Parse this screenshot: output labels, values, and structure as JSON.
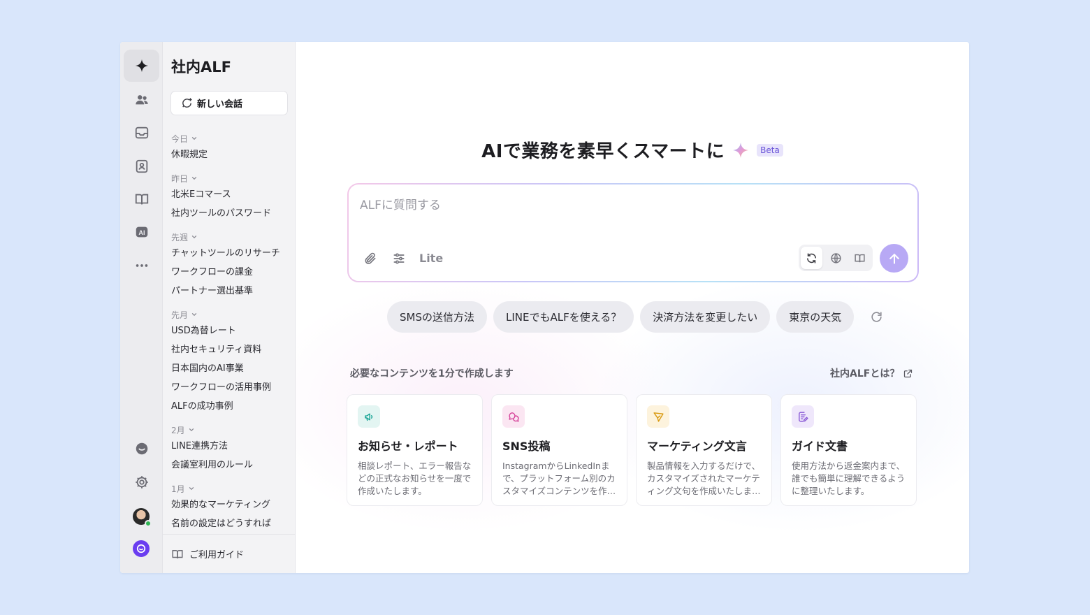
{
  "app": {
    "title": "社内ALF"
  },
  "rail": {
    "items": [
      {
        "icon": "sparkle-icon",
        "active": true
      },
      {
        "icon": "team-icon"
      },
      {
        "icon": "inbox-icon"
      },
      {
        "icon": "contacts-icon"
      },
      {
        "icon": "book-icon"
      },
      {
        "icon": "ai-icon"
      },
      {
        "icon": "more-icon"
      }
    ],
    "bottom": [
      "chat-bubble-icon",
      "gear-icon",
      "avatar",
      "app-logo"
    ]
  },
  "sidebar": {
    "new_chat_label": "新しい会話",
    "groups": [
      {
        "label": "今日",
        "items": [
          "休暇規定"
        ]
      },
      {
        "label": "昨日",
        "items": [
          "北米Eコマース",
          "社内ツールのパスワード"
        ]
      },
      {
        "label": "先週",
        "items": [
          "チャットツールのリサーチ",
          "ワークフローの課金",
          "パートナー選出基準"
        ]
      },
      {
        "label": "先月",
        "items": [
          "USD為替レート",
          "社内セキュリティ資料",
          "日本国内のAI事業",
          "ワークフローの活用事例",
          "ALFの成功事例"
        ]
      },
      {
        "label": "2月",
        "items": [
          "LINE連携方法",
          "会議室利用のルール"
        ]
      },
      {
        "label": "1月",
        "items": [
          "効果的なマーケティング",
          "名前の設定はどうすれば"
        ]
      }
    ],
    "guide_label": "ご利用ガイド"
  },
  "main": {
    "headline": "AIで業務を素早くスマートに",
    "beta_label": "Beta",
    "input": {
      "placeholder": "ALFに質問する",
      "value": ""
    },
    "model_label": "Lite",
    "suggestions": [
      "SMSの送信方法",
      "LINEでもALFを使える？",
      "決済方法を変更したい",
      "東京の天気"
    ],
    "section_title": "必要なコンテンツを1分で作成します",
    "about_link": "社内ALFとは？",
    "cards": [
      {
        "title": "お知らせ・レポート",
        "desc": "相談レポート、エラー報告などの正式なお知らせを一度で作成いたします。",
        "icon": "megaphone-icon",
        "color": "#16a394",
        "bg": "#e3f5f2"
      },
      {
        "title": "SNS投稿",
        "desc": "InstagramからLinkedInまで、プラットフォーム別のカスタマイズコンテンツを作成します。",
        "icon": "chat-bubbles-icon",
        "color": "#d6459b",
        "bg": "#fbe6f2"
      },
      {
        "title": "マーケティング文言",
        "desc": "製品情報を入力するだけで、カスタマイズされたマーケティング文句を作成いたします。",
        "icon": "send-icon",
        "color": "#d99a12",
        "bg": "#fdf3dd"
      },
      {
        "title": "ガイド文書",
        "desc": "使用方法から返金案内まで、誰でも簡単に理解できるように整理いたします。",
        "icon": "document-edit-icon",
        "color": "#8b5cd6",
        "bg": "#efe7fb"
      }
    ]
  }
}
